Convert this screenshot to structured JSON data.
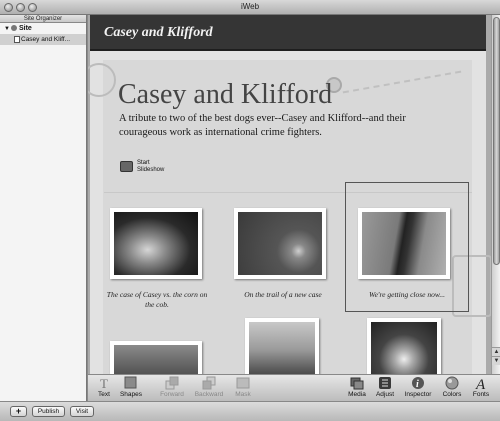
{
  "window": {
    "title": "iWeb"
  },
  "sidebar": {
    "header": "Site Organizer",
    "site_label": "Site",
    "page_label": "Casey and Kliff..."
  },
  "page": {
    "header_title": "Casey and Klifford",
    "main_title": "Casey and Klifford",
    "intro": "A tribute to two of the best dogs ever--Casey and Klifford--and their courageous work as international crime fighters.",
    "slideshow_label_line1": "Start",
    "slideshow_label_line2": "Slideshow",
    "captions": [
      "The case of Casey vs. the corn on the cob.",
      "On the trail of a new case",
      "We're getting close now..."
    ]
  },
  "toolbar": {
    "items": [
      {
        "label": "Text",
        "icon": "text-icon",
        "enabled": true
      },
      {
        "label": "Shapes",
        "icon": "shapes-icon",
        "enabled": true
      },
      {
        "label": "Forward",
        "icon": "forward-icon",
        "enabled": false
      },
      {
        "label": "Backward",
        "icon": "backward-icon",
        "enabled": false
      },
      {
        "label": "Mask",
        "icon": "mask-icon",
        "enabled": false
      },
      {
        "label": "Media",
        "icon": "media-icon",
        "enabled": true
      },
      {
        "label": "Adjust",
        "icon": "adjust-icon",
        "enabled": true
      },
      {
        "label": "Inspector",
        "icon": "inspector-icon",
        "enabled": true
      },
      {
        "label": "Colors",
        "icon": "colors-icon",
        "enabled": true
      },
      {
        "label": "Fonts",
        "icon": "fonts-icon",
        "enabled": true
      }
    ]
  },
  "bottombar": {
    "add_label": "+",
    "publish_label": "Publish",
    "visit_label": "Visit"
  }
}
